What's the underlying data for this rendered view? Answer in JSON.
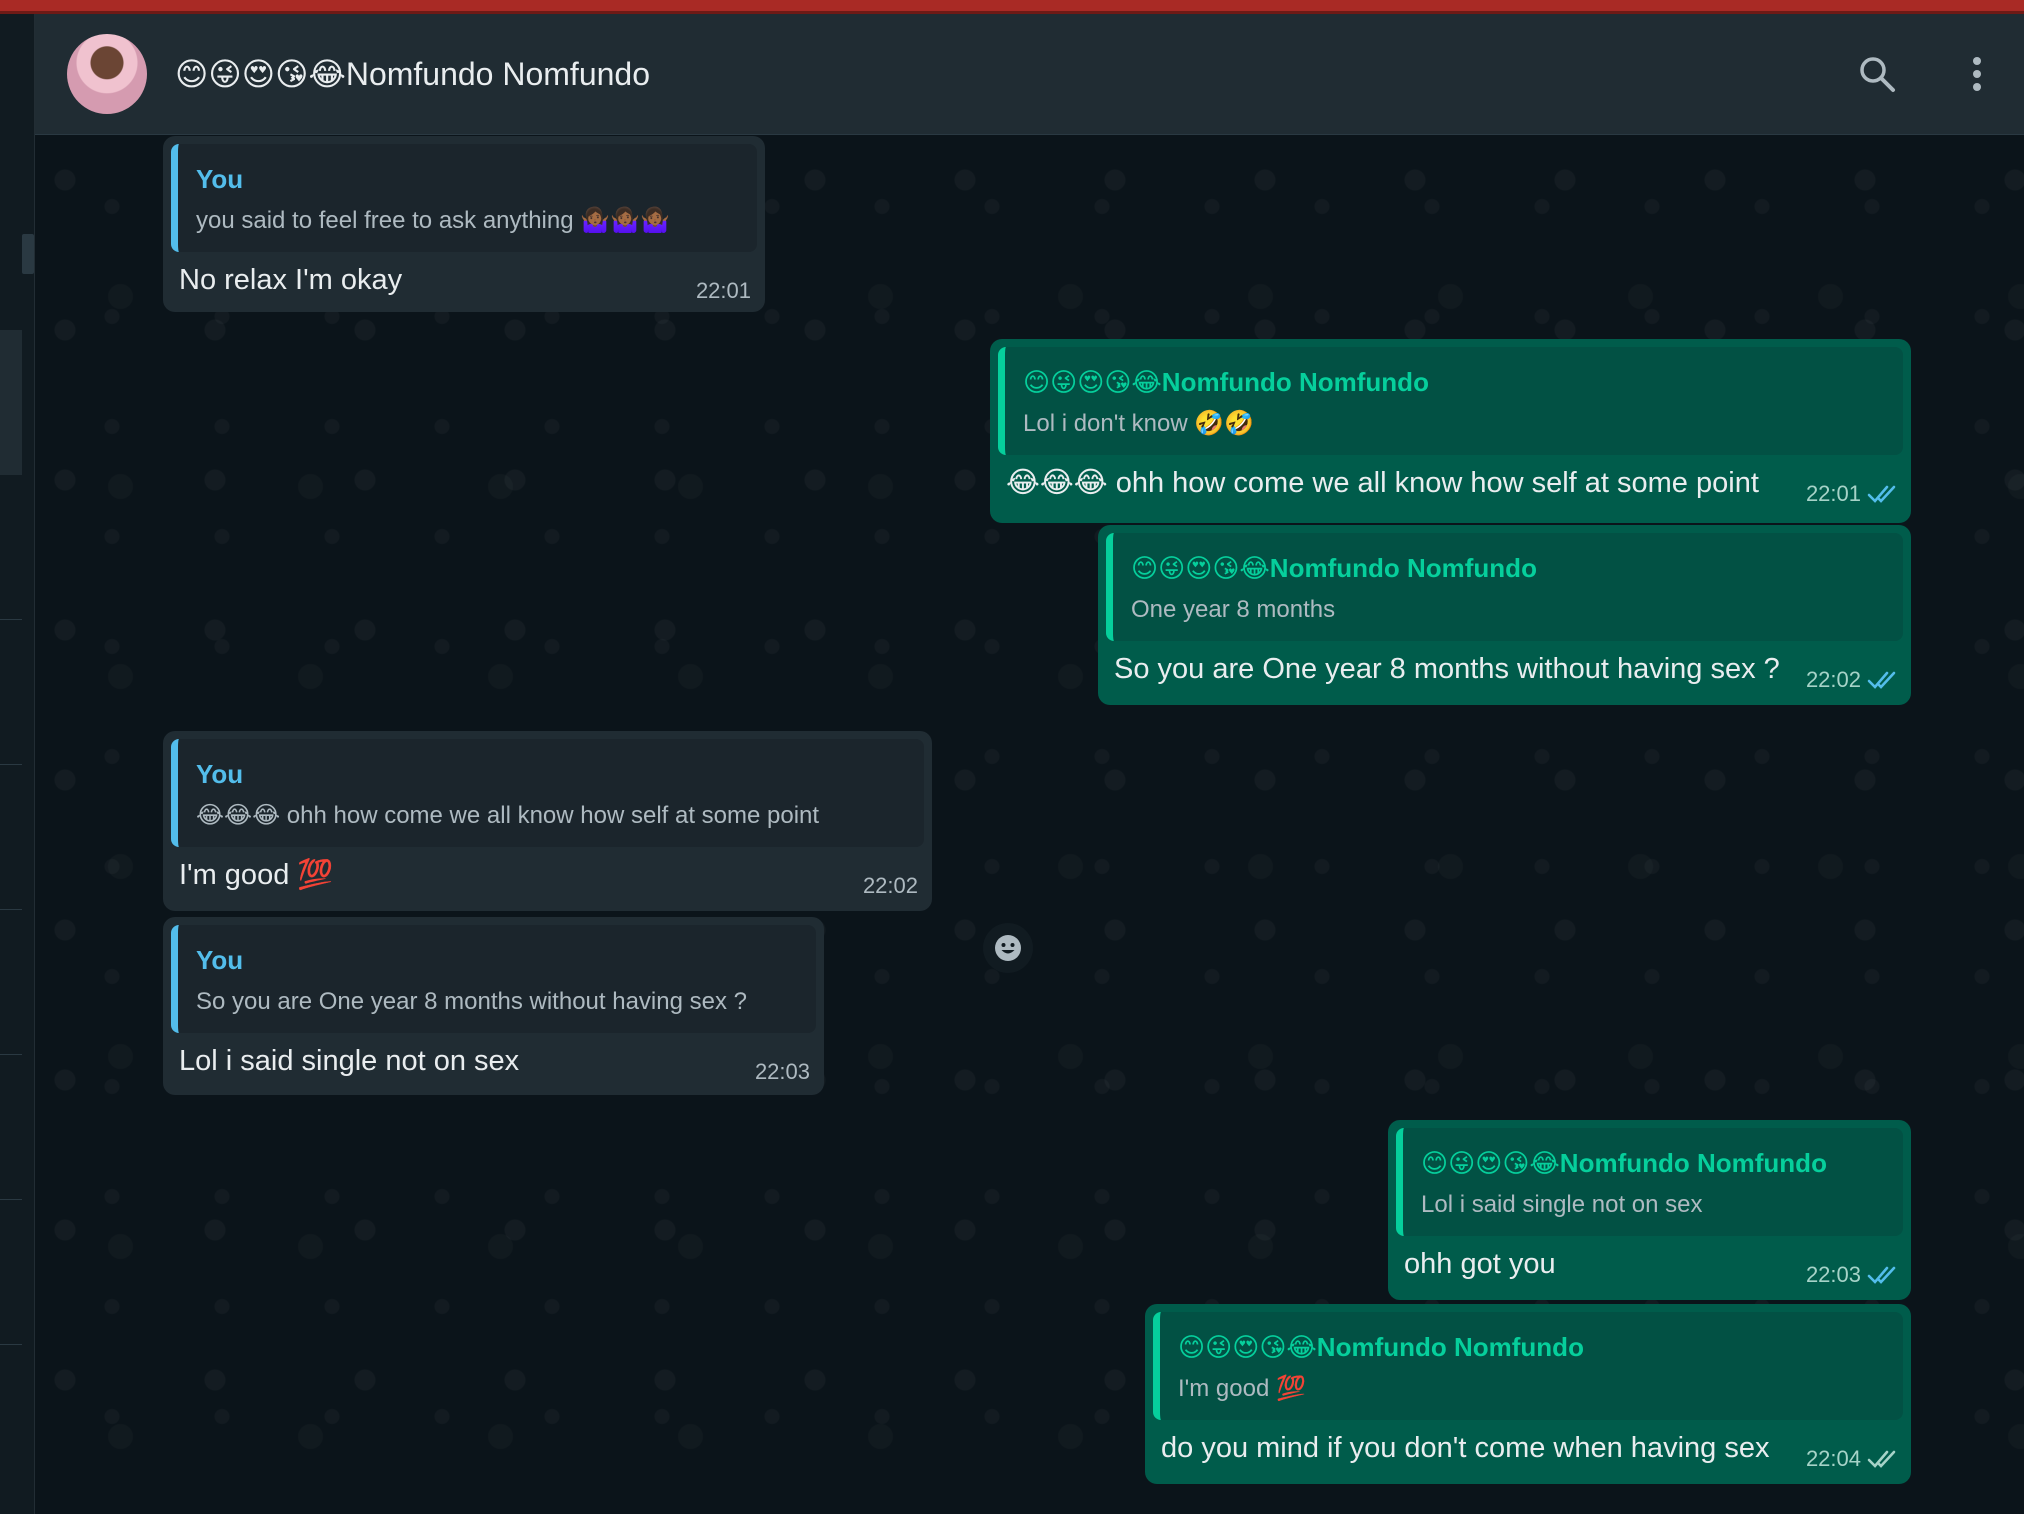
{
  "contact": {
    "name": "😊😜😍😘😂Nomfundo Nomfundo"
  },
  "header_icons": {
    "search": "search-icon",
    "menu": "vertical-dots-icon"
  },
  "colors": {
    "incoming_bubble": "#202c33",
    "outgoing_bubble": "#005c4b",
    "quote_you_accent": "#53bdeb",
    "quote_contact_accent": "#06cf9c",
    "read_tick": "#53bdeb"
  },
  "messages": [
    {
      "direction": "incoming",
      "quote_author": "You",
      "quote_text": "you said to feel free to ask anything 🤷🏾‍♀️🤷🏾‍♀️🤷🏾‍♀️",
      "text": "No relax I'm okay",
      "time": "22:01"
    },
    {
      "direction": "outgoing",
      "quote_author": "😊😜😍😘😂Nomfundo Nomfundo",
      "quote_text": "Lol i don't know 🤣🤣",
      "text": "😂😂😂 ohh how come we all know how self at some point",
      "time": "22:01",
      "status": "read"
    },
    {
      "direction": "outgoing",
      "quote_author": "😊😜😍😘😂Nomfundo Nomfundo",
      "quote_text": "One year 8 months",
      "text": "So you are One year 8 months without having sex ?",
      "time": "22:02",
      "status": "read"
    },
    {
      "direction": "incoming",
      "quote_author": "You",
      "quote_text": "😂😂😂 ohh how come we all know how self at some point",
      "text": "I'm good 💯",
      "time": "22:02"
    },
    {
      "direction": "incoming",
      "quote_author": "You",
      "quote_text": "So you are One year 8 months without having sex ?",
      "text": "Lol i said single not on sex",
      "time": "22:03"
    },
    {
      "direction": "outgoing",
      "quote_author": "😊😜😍😘😂Nomfundo Nomfundo",
      "quote_text": "Lol i said single not on sex",
      "text": "ohh got you",
      "time": "22:03",
      "status": "read"
    },
    {
      "direction": "outgoing",
      "quote_author": "😊😜😍😘😂Nomfundo Nomfundo",
      "quote_text": "I'm good 💯",
      "text": "do you mind if you don't come when having sex",
      "time": "22:04",
      "status": "delivered"
    }
  ],
  "reaction_button_icon": "smiley-icon"
}
